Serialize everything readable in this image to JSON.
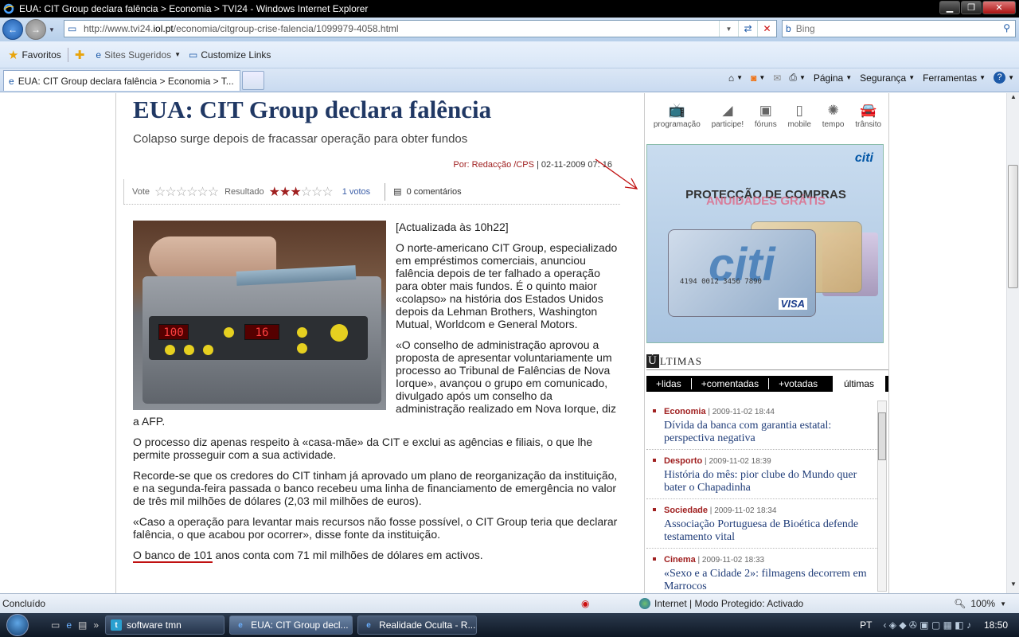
{
  "window": {
    "title": "EUA: CIT Group declara falência > Economia > TVI24 - Windows Internet Explorer"
  },
  "nav": {
    "url_prefix": "http://www.tvi24.",
    "url_domain": "iol.pt",
    "url_path": "/economia/citgroup-crise-falencia/1099979-4058.html",
    "search_placeholder": "Bing"
  },
  "favbar": {
    "favorites": "Favoritos",
    "suggested": "Sites Sugeridos",
    "customize": "Customize Links"
  },
  "tabs": {
    "active": "EUA: CIT Group declara falência > Economia > T..."
  },
  "commandbar": {
    "page": "Página",
    "security": "Segurança",
    "tools": "Ferramentas"
  },
  "article": {
    "headline": "EUA: CIT Group declara falência",
    "lead": "Colapso surge depois de fracassar operação para obter fundos",
    "author": "Por: Redacção /CPS",
    "date": "02-11-2009 07: 16",
    "vote_label": "Vote",
    "result_label": "Resultado",
    "rating": 3,
    "rating_max": 6,
    "votes": "1 votos",
    "comments": "0 comentários",
    "updated": "[Actualizada às 10h22]",
    "p1": "O norte-americano CIT Group, especializado em empréstimos comerciais, anunciou falência depois de ter falhado a operação para obter mais fundos. É o quinto maior «colapso» na história dos Estados Unidos depois da Lehman Brothers, Washington Mutual, Worldcom e General Motors.",
    "p2": "«O conselho de administração aprovou a proposta de apresentar voluntariamente um processo ao Tribunal de Falências de Nova Iorque», avançou o grupo em comunicado, divulgado após um conselho da administração realizado em Nova Iorque, diz a AFP.",
    "p3": "O processo diz apenas respeito à «casa-mãe» da CIT e exclui as agências e filiais, o que lhe permite prosseguir com a sua actividade.",
    "p4": "Recorde-se que os credores do CIT tinham já aprovado um plano de reorganização da instituição, e na segunda-feira passada o banco recebeu uma linha de financiamento de emergência no valor de três mil milhões de dólares (2,03 mil milhões de euros).",
    "p5": "«Caso a operação para levantar mais recursos não fosse possível, o CIT Group teria que declarar falência, o que acabou por ocorrer», disse fonte da instituição.",
    "p6_link": "O banco de 101",
    "p6_rest": " anos conta com 71 mil milhões de dólares em activos.",
    "machine_display1": "100",
    "machine_display2": "16"
  },
  "sidebar": {
    "icons": [
      {
        "label": "programação",
        "icon": "tv-icon"
      },
      {
        "label": "participe!",
        "icon": "megaphone-icon"
      },
      {
        "label": "fóruns",
        "icon": "forum-icon"
      },
      {
        "label": "mobile",
        "icon": "mobile-icon"
      },
      {
        "label": "tempo",
        "icon": "weather-icon"
      },
      {
        "label": "trânsito",
        "icon": "car-icon"
      }
    ],
    "ad": {
      "logo": "citi",
      "line1": "PROTECÇÃO DE COMPRAS",
      "line2": "ANUIDADES GRÁTIS",
      "card_brand": "citi",
      "card_number": "4194 0012 3456 7890",
      "visa": "VISA"
    },
    "ultimas_cap": "Ú",
    "ultimas_rest": "LTIMAS",
    "tabs": [
      "+lidas",
      "+comentadas",
      "+votadas",
      "últimas"
    ],
    "news": [
      {
        "cat": "Economia",
        "date": "2009-11-02 18:44",
        "title": "Dívida da banca com garantia estatal: perspectiva negativa"
      },
      {
        "cat": "Desporto",
        "date": "2009-11-02 18:39",
        "title": "História do mês: pior clube do Mundo quer bater o Chapadinha"
      },
      {
        "cat": "Sociedade",
        "date": "2009-11-02 18:34",
        "title": "Associação Portuguesa de Bioética defende testamento vital"
      },
      {
        "cat": "Cinema",
        "date": "2009-11-02 18:33",
        "title": "«Sexo e a Cidade 2»: filmagens decorrem em Marrocos"
      }
    ]
  },
  "statusbar": {
    "status": "Concluído",
    "zone": "Internet | Modo Protegido: Activado",
    "zoom": "100%"
  },
  "taskbar": {
    "tasks": [
      "software tmn",
      "EUA: CIT Group decl...",
      "Realidade Oculta - R..."
    ],
    "lang": "PT",
    "clock": "18:50"
  }
}
